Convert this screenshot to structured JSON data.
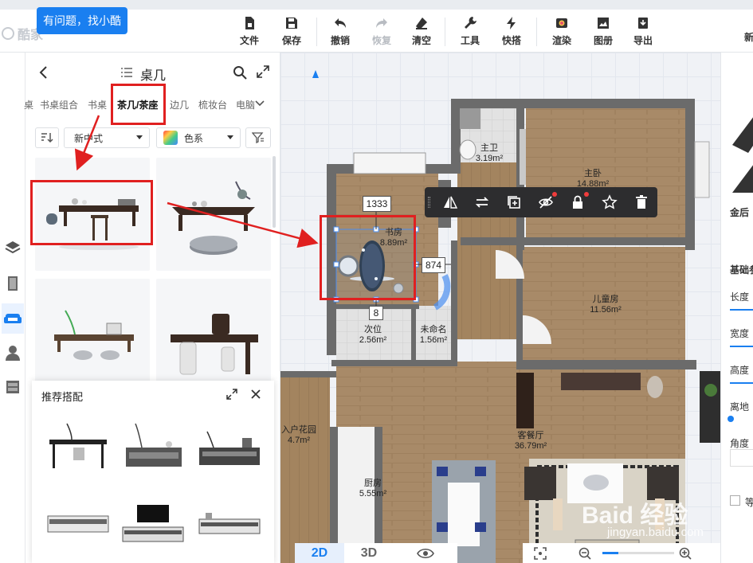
{
  "app": {
    "logo_text": "酷家",
    "help_button": "有问题，找小酷"
  },
  "toolbar": [
    {
      "label": "文件",
      "icon": "file-icon",
      "disabled": false
    },
    {
      "label": "保存",
      "icon": "save-icon",
      "disabled": false
    },
    {
      "label": "撤销",
      "icon": "undo-icon",
      "disabled": false
    },
    {
      "label": "恢复",
      "icon": "redo-icon",
      "disabled": true
    },
    {
      "label": "清空",
      "icon": "eraser-icon",
      "disabled": false
    },
    {
      "label": "工具",
      "icon": "wrench-icon",
      "disabled": false
    },
    {
      "label": "快搭",
      "icon": "lightning-icon",
      "disabled": false
    },
    {
      "label": "渲染",
      "icon": "camera-icon",
      "disabled": false
    },
    {
      "label": "图册",
      "icon": "album-icon",
      "disabled": false
    },
    {
      "label": "导出",
      "icon": "export-icon",
      "disabled": false
    }
  ],
  "panel": {
    "title": "桌几",
    "categories": [
      "桌",
      "书桌组合",
      "书桌",
      "茶几/茶座",
      "边几",
      "梳妆台",
      "电脑"
    ],
    "active_category": "茶几/茶座",
    "style_filter": "新中式",
    "color_filter": "色系"
  },
  "recommend": {
    "title": "推荐搭配"
  },
  "floorplan": {
    "rooms": [
      {
        "name": "主卫",
        "area": "3.19m²"
      },
      {
        "name": "主卧",
        "area": "14.88m²"
      },
      {
        "name": "书房",
        "area": "8.89m²"
      },
      {
        "name": "儿童房",
        "area": "11.56m²"
      },
      {
        "name": "次位",
        "area": "2.56m²"
      },
      {
        "name": "未命名",
        "area": "1.56m²"
      },
      {
        "name": "入户花园",
        "area": "4.7m²"
      },
      {
        "name": "客餐厅",
        "area": "36.79m²"
      },
      {
        "name": "厨房",
        "area": "5.55m²"
      }
    ],
    "dims": [
      "1333",
      "874",
      "8"
    ]
  },
  "right_panel": {
    "section1": "金后",
    "section2": "基础参",
    "length": "长度",
    "width": "宽度",
    "height": "高度",
    "ground": "离地",
    "angle": "角度",
    "equal": "等",
    "new_label": "新"
  },
  "view": {
    "mode_2d": "2D",
    "mode_3d": "3D"
  },
  "watermark": {
    "text": "Baid  经验",
    "url": "jingyan.baidu.com"
  },
  "colors": {
    "accent": "#1a7ff0",
    "annotation": "#e02020",
    "wood": "#a88a68",
    "wall": "#6b6b6b"
  }
}
